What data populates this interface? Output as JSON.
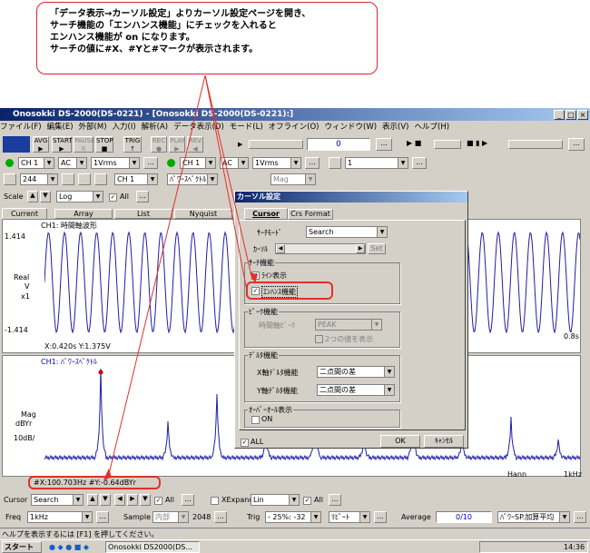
{
  "callout": {
    "lines": [
      "「データ表示→カーソル設定」よりカーソル設定ページを開き、",
      "サーチ機能の「エンハンス機能」にチェックを入れると",
      "エンハンス機能が on になります。",
      "サーチの値に#X、#Yと#マークが表示されます。"
    ]
  },
  "window": {
    "title": "Onosokki DS-2000(DS-0221) - [Onosokki DS-2000(DS-0221):]"
  },
  "menu": [
    "ファイル(F)",
    "編集(E)",
    "外部(M)",
    "入力(I)",
    "解析(A)",
    "データ表示(D)",
    "モード(L)",
    "オフライン(O)",
    "ウィンドウ(W)",
    "表示(V)",
    "ヘルプ(H)"
  ],
  "toolbar": {
    "avg": "AVG",
    "start": "START",
    "pause": "PAUSE",
    "stop": "STOP",
    "trig": "TRIG",
    "rec": "REC",
    "play": "PLAY",
    "rev": "REV",
    "counter": "0",
    "aux_ch": "1"
  },
  "input_row": {
    "ch1": "CH 1",
    "coupling1": "AC",
    "range1": "1Vrms",
    "ch2": "CH 1",
    "coupling2": "AC",
    "range2": "1Vrms"
  },
  "func_row": {
    "lines": "244",
    "ch": "CH 1",
    "func": "ﾊﾟﾜｰｽﾍﾟｸﾄﾙ",
    "mag": "Mag"
  },
  "scale_row": {
    "label": "Scale",
    "mode": "Log",
    "all": "All"
  },
  "tabs": [
    "Current",
    "Array",
    "List",
    "Nyquist"
  ],
  "graph1": {
    "title": "CH1: 時間軸波形",
    "ytop": "1.414",
    "ybot": "-1.414",
    "ylabel": [
      "Real",
      "V",
      "x1"
    ],
    "cursor": "X:0.420s Y:1.375V",
    "xend": "0.8s"
  },
  "graph2": {
    "title": "CH1: ﾊﾟﾜｰｽﾍﾟｸﾄﾙ",
    "ylabel": [
      "Mag",
      "dBYr",
      "10dB/"
    ],
    "window": "Hann",
    "xend": "1kHz",
    "cursor": "#X:100.703Hz #Y:-0.64dBYr"
  },
  "cursor_row": {
    "label": "Cursor",
    "mode": "Search",
    "all": "All",
    "xexpand": "XExpand",
    "lin": "Lin",
    "all2": "All"
  },
  "bottom_row": {
    "freq": "Freq",
    "freq_val": "1kHz",
    "sample": "Sample",
    "sample_val": "内部",
    "points": "2048",
    "trig": "Trig",
    "trig_val": "- 25%: -32",
    "repeat": "ﾘﾋﾟｰﾄ",
    "average": "Average",
    "avg_val": "0/10",
    "avg_mode": "ﾊﾟﾜｰSP.加算平均"
  },
  "status": "ヘルプを表示するには [F1] を押してください。",
  "taskbar": {
    "start": "スタート",
    "task": "Onosokki DS2000(DS...",
    "clock": "14:36"
  },
  "dialog": {
    "title": "カーソル設定",
    "tab_cursor": "Cursor",
    "tab_format": "Crs Format",
    "search_mode_label": "ｻｰﾁﾓｰﾄﾞ",
    "search_mode": "Search",
    "cursor_label": "ｶｰｿﾙ",
    "set": "Set",
    "search_group": "ｻｰﾁ機能",
    "line_disp": "ﾗｲﾝ表示",
    "enhance": "ｴﾝﾊﾝｽ機能",
    "peak_group": "ﾋﾟｰｸ機能",
    "peak_label": "時間軸ﾋﾟｰｸ",
    "peak_val": "PEAK",
    "two_values": "2つの値を表示",
    "delta_group": "ﾃﾞﾙﾀ機能",
    "x_delta": "X軸ﾃﾞﾙﾀ機能",
    "x_delta_val": "二点間の差",
    "y_delta": "Y軸ﾃﾞﾙﾀ機能",
    "y_delta_val": "二点間の差",
    "overall_group": "ｵｰﾊﾞｰｵｰﾙ表示",
    "on": "ON",
    "all": "ALL",
    "ok": "OK",
    "cancel": "ｷｬﾝｾﾙ"
  }
}
